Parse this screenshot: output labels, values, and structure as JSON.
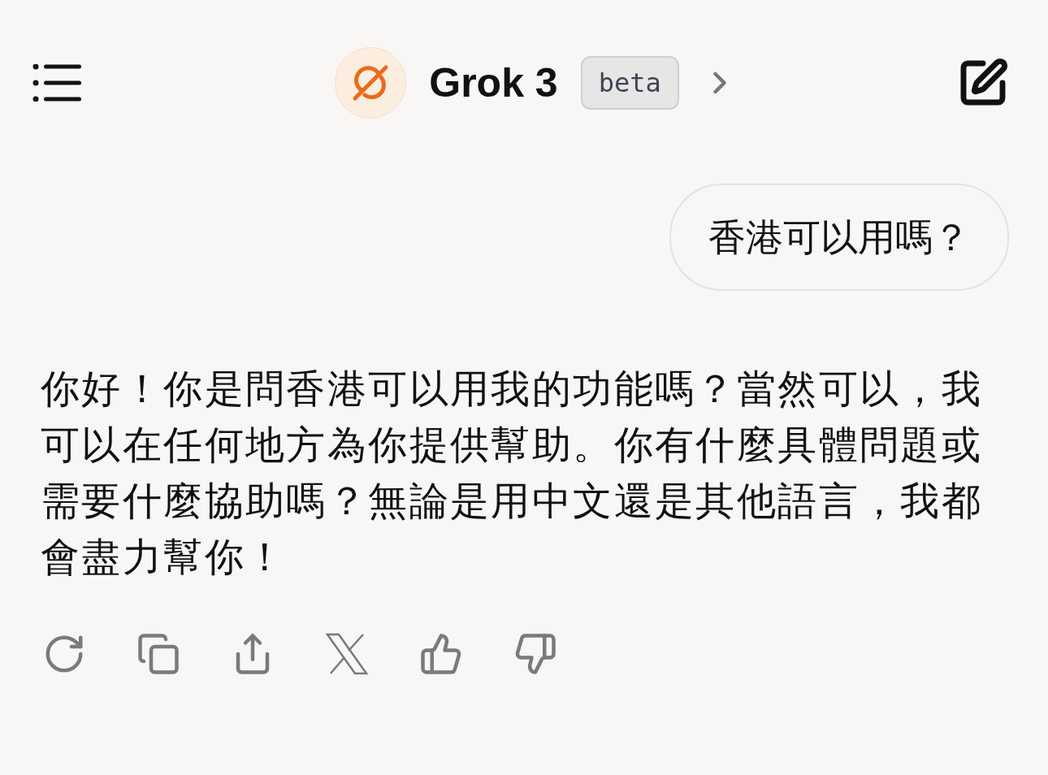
{
  "header": {
    "title": "Grok 3",
    "badge": "beta"
  },
  "messages": [
    {
      "kind": "user",
      "text": "香港可以用嗎？"
    },
    {
      "kind": "assistant",
      "text": "你好！你是問香港可以用我的功能嗎？當然可以，我可以在任何地方為你提供幫助。你有什麼具體問題或需要什麼協助嗎？無論是用中文還是其他語言，我都會盡力幫你！"
    }
  ]
}
